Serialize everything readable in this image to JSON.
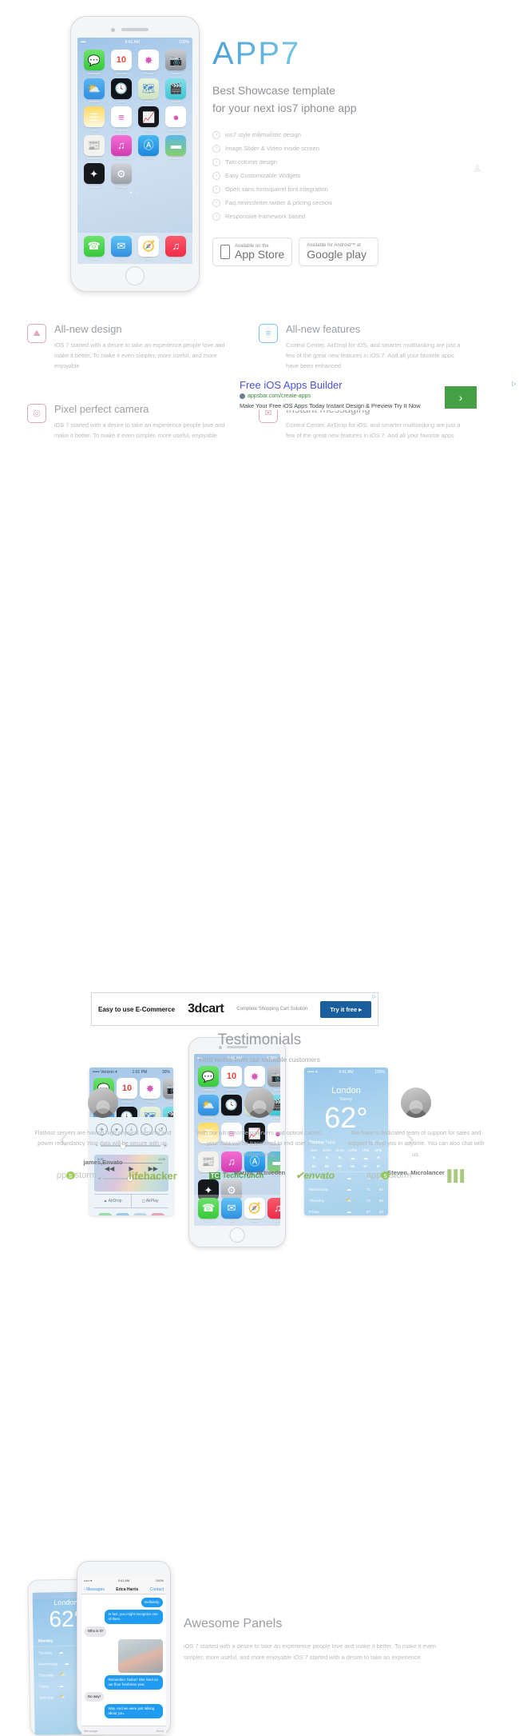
{
  "hero": {
    "brand": "APP7",
    "tagline_line1": "Best Showcase template",
    "tagline_line2": "for your next ios7 iphone app",
    "features": [
      "ios7 style milimalistic design",
      "Image Slider & Video inside screen",
      "Two column design",
      "Easy Customizable Widgets",
      "Open sans fontsquirrel font integration",
      "Faq.newssletter.twitter & pricing section",
      "Responsive framework based"
    ],
    "stores": {
      "apple_sub": "Available on the",
      "apple_main": "App Store",
      "google_sub": "Available for Android™ at",
      "google_main_1": "Google",
      "google_main_2": "play"
    },
    "scroll_top_icon": "chevron-up-icon"
  },
  "phone_home": {
    "status_signal": "•••••",
    "status_wifi": "▾",
    "status_time": "9:41 AM",
    "status_battery": "100%",
    "apps": [
      {
        "name": "Messages",
        "glyph": "💬",
        "bg": "linear-gradient(180deg,#6ee26b,#36c93a)"
      },
      {
        "name": "Calendar",
        "glyph": "10",
        "bg": "#ffffff"
      },
      {
        "name": "Photos",
        "glyph": "✸",
        "bg": "#ffffff"
      },
      {
        "name": "Camera",
        "glyph": "📷",
        "bg": "linear-gradient(180deg,#c9ccd1,#8d9196)"
      },
      {
        "name": "Weather",
        "glyph": "⛅",
        "bg": "linear-gradient(180deg,#5ab5f0,#2f8ee0)"
      },
      {
        "name": "Clock",
        "glyph": "🕓",
        "bg": "#111418"
      },
      {
        "name": "Maps",
        "glyph": "🗺",
        "bg": "linear-gradient(180deg,#eaf3df,#cfe3bf)"
      },
      {
        "name": "Videos",
        "glyph": "🎬",
        "bg": "linear-gradient(180deg,#7fe0e8,#3ec6d4)"
      },
      {
        "name": "Notes",
        "glyph": "☰",
        "bg": "linear-gradient(180deg,#ffd95e,#fff8e0)"
      },
      {
        "name": "Reminders",
        "glyph": "≡",
        "bg": "#ffffff"
      },
      {
        "name": "Stocks",
        "glyph": "📈",
        "bg": "#15171b"
      },
      {
        "name": "Game Center",
        "glyph": "●",
        "bg": "#ffffff"
      },
      {
        "name": "Newsstand",
        "glyph": "📰",
        "bg": "#f3f2ee"
      },
      {
        "name": "iTunes Store",
        "glyph": "♫",
        "bg": "linear-gradient(180deg,#f46fd4,#d23ab0)"
      },
      {
        "name": "App Store",
        "glyph": "Ⓐ",
        "bg": "linear-gradient(180deg,#46b9f2,#1d86dc)"
      },
      {
        "name": "Passbook",
        "glyph": "▬",
        "bg": "linear-gradient(180deg,#5bb8e8,#86cf6b)"
      },
      {
        "name": "Compass",
        "glyph": "✦",
        "bg": "#16181c"
      },
      {
        "name": "Settings",
        "glyph": "⚙",
        "bg": "linear-gradient(180deg,#d2d5d9,#9aa0a6)"
      }
    ],
    "page_dots": "● ○",
    "dock": [
      {
        "name": "Phone",
        "glyph": "☎",
        "bg": "linear-gradient(180deg,#6ee26b,#36c93a)"
      },
      {
        "name": "Mail",
        "glyph": "✉",
        "bg": "linear-gradient(180deg,#5fc4f5,#2f8ee0)"
      },
      {
        "name": "Safari",
        "glyph": "🧭",
        "bg": "#ffffff"
      },
      {
        "name": "Music",
        "glyph": "♫",
        "bg": "linear-gradient(180deg,#fa5a6a,#ef2b48)"
      }
    ]
  },
  "features": [
    {
      "icon": "image-icon",
      "glyph": "⛰",
      "color": "#e0a8bb",
      "title": "All-new design",
      "body": "iOS 7 started with a desire to take an experience people love and make it better. To make it even simpler, more useful, and more enjoyable"
    },
    {
      "icon": "chat-lines-icon",
      "glyph": "≡",
      "color": "#7fc4e8",
      "title": "All-new features",
      "body": "Control Center, AirDrop for iOS, and smarter multitasking are just a few of the great new features in iOS 7. And all your favorite apps have been enhanced"
    },
    {
      "icon": "camera-icon",
      "glyph": "◎",
      "color": "#e0a8bb",
      "title": "Pixel perfect camera",
      "body": "iOS 7 started with a desire to take an experience people love and make it better. To make it even simpler, more useful, enjoyable"
    },
    {
      "icon": "envelope-icon",
      "glyph": "✉",
      "color": "#e0a8bb",
      "title": "Instant messaging",
      "body": "Control Center, AirDrop for iOS, and smarter multitasking are just a few of the great new features in iOS 7. And all your favorite apps"
    }
  ],
  "inline_ad": {
    "title": "Free iOS Apps Builder",
    "url": "appsbar.com/create-apps",
    "desc": "Make Your Free iOS Apps Today Instant Design & Preview Try It Now",
    "arrow_glyph": "›",
    "arrow_color": "#46a046",
    "adchoices_glyph": "▷"
  },
  "slider": {
    "prev_icon": "chevron-left-icon",
    "next_icon": "chevron-right-icon",
    "prev_glyph": "‹",
    "next_glyph": "›"
  },
  "control_center": {
    "status_carrier": "••••• Verizon ▾",
    "status_time": "1:01 PM",
    "status_battery": "30%",
    "toggles": [
      {
        "name": "airplane-mode-toggle",
        "glyph": "✈"
      },
      {
        "name": "wifi-toggle",
        "glyph": "▾"
      },
      {
        "name": "bluetooth-toggle",
        "glyph": "ᛦ"
      },
      {
        "name": "do-not-disturb-toggle",
        "glyph": "☾"
      },
      {
        "name": "rotation-lock-toggle",
        "glyph": "↺"
      }
    ],
    "brightness_low": "☀",
    "brightness_high": "☀",
    "time_start": "0:00",
    "time_end": "-0:00",
    "prev_glyph": "◀◀",
    "play_glyph": "▶",
    "next_glyph": "▶▶",
    "vol_low": "◂",
    "vol_high": "▸",
    "airdrop": "AirDrop",
    "airplay": "AirPlay",
    "apps": [
      {
        "name": "flashlight-shortcut",
        "glyph": "🔦",
        "bg": "#9bdda8"
      },
      {
        "name": "timer-shortcut",
        "glyph": "⏱",
        "bg": "#9dc9e8"
      },
      {
        "name": "calculator-shortcut",
        "glyph": "⌨",
        "bg": "#bcd6e8"
      },
      {
        "name": "camera-shortcut",
        "glyph": "📷",
        "bg": "#e7a6b8"
      }
    ]
  },
  "weather": {
    "status_carrier": "••••• ▾",
    "status_time": "9:41 AM",
    "status_battery": "100%",
    "city": "London",
    "condition": "Sunny",
    "temp": "62°",
    "today_day": "Monday",
    "today_label": "Today",
    "today_hi": "67",
    "today_lo": "47",
    "hours": [
      "Now",
      "10AM",
      "11AM",
      "12PM",
      "1PM",
      "2PM"
    ],
    "hour_icons": [
      "☀",
      "☀",
      "☀",
      "☁",
      "☁",
      "☀"
    ],
    "hour_temps": [
      "62",
      "63",
      "65",
      "66",
      "67",
      "67"
    ],
    "days": [
      {
        "name": "Tuesday",
        "icon": "☁",
        "hi": "71",
        "lo": "54"
      },
      {
        "name": "Wednesday",
        "icon": "☁",
        "hi": "71",
        "lo": "52"
      },
      {
        "name": "Thursday",
        "icon": "⛅",
        "hi": "72",
        "lo": "56"
      },
      {
        "name": "Friday",
        "icon": "☁",
        "hi": "67",
        "lo": "53"
      },
      {
        "name": "Saturday",
        "icon": "⛅",
        "hi": "64",
        "lo": "50"
      }
    ]
  },
  "messages_panel": {
    "status_signal": "••••• ▾",
    "status_time": "9:41 AM",
    "status_battery": "100%",
    "back_label": "Messages",
    "contact_name": "Erica Harris",
    "contact_action": "Contact",
    "bubbles": [
      {
        "side": "me",
        "text": "Definitely."
      },
      {
        "side": "me",
        "text": "In fact, you might recognize one of them."
      },
      {
        "side": "them",
        "text": "Who is it?"
      },
      {
        "side": "image",
        "text": ""
      },
      {
        "side": "me",
        "text": "Remember Tasha? She lived on our floor freshman year."
      },
      {
        "side": "them",
        "text": "No way!"
      },
      {
        "side": "me",
        "text": "Way. And we were just talking about you."
      }
    ],
    "input_placeholder": "iMessage",
    "send_label": "Send"
  },
  "panels_section": {
    "title": "Awesome Panels",
    "body": "iOS 7 started with a desire to take an experience people love and make it better. To make it even simpler, more useful, and more enjoyable iOS 7 started with a desire to take an experience"
  },
  "banner_ad": {
    "left_text": "Easy to use E-Commerce",
    "logo": "3dcart",
    "mid_text": "Complete Shopping Cart Solution",
    "cta": "Try it free  ▸",
    "close_glyph": "▷"
  },
  "testimonials": {
    "title": "Testimonials",
    "subtitle": "Kind words from our valuable customers",
    "items": [
      {
        "avatar": "avatar-james",
        "text": "Flathost servers are having high physical security and power redundancy Your data will be secure with us.",
        "name": "james,Envato"
      },
      {
        "avatar": "avatar-mariya",
        "text": "With our ultra mordern servers and optical cables, your data will be transfered to end user in milliseconds.",
        "name": "Mariya, Activeden"
      },
      {
        "avatar": "avatar-steven",
        "text": "We have a dedicated team of support for sales and support to help you in anytime. You can also chat with us.",
        "name": "Steven, Microlancer"
      }
    ]
  },
  "brands": [
    {
      "name": "appstorm",
      "pre": "pp",
      "mid": "s",
      "post": "storm"
    },
    {
      "name": "lifehacker",
      "label": "lifehacker"
    },
    {
      "name": "techcrunch",
      "mark": "TC",
      "label": "TechCrunch"
    },
    {
      "name": "envato",
      "label": "✔envato"
    },
    {
      "name": "appstorm2",
      "pre": "app",
      "mid": "s",
      "post": "storm"
    },
    {
      "name": "bars",
      "label": "▐▐▐"
    }
  ]
}
